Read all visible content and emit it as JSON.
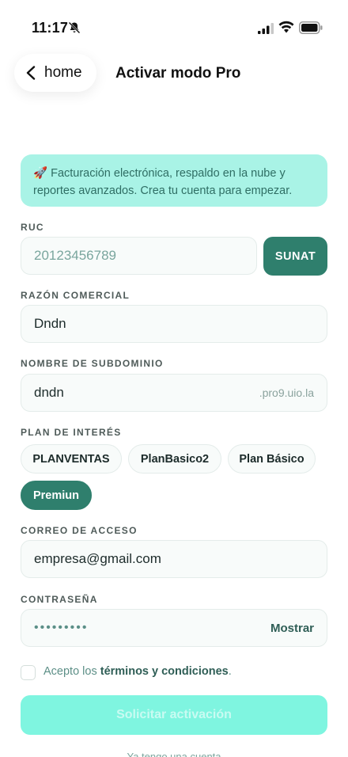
{
  "status_bar": {
    "time": "11:17"
  },
  "header": {
    "back_label": "home",
    "title": "Activar modo Pro"
  },
  "banner": {
    "emoji": "🚀",
    "text": "Facturación electrónica, respaldo en la nube y reportes avanzados. Crea tu cuenta para empezar."
  },
  "ruc": {
    "label": "RUC",
    "placeholder": "20123456789",
    "button_label": "SUNAT"
  },
  "razon": {
    "label": "RAZÓN COMERCIAL",
    "value": "Dndn"
  },
  "subdominio": {
    "label": "NOMBRE DE SUBDOMINIO",
    "value": "dndn",
    "suffix": ".pro9.uio.la"
  },
  "plan": {
    "label": "PLAN DE INTERÉS",
    "options": [
      "PLANVENTAS",
      "PlanBasico2",
      "Plan Básico",
      "Premiun"
    ],
    "selected": "Premiun"
  },
  "correo": {
    "label": "CORREO DE ACCESO",
    "value": "empresa@gmail.com"
  },
  "password": {
    "label": "CONTRASEÑA",
    "masked_value": "•••••••••",
    "toggle_label": "Mostrar"
  },
  "terms": {
    "prefix": "Acepto los ",
    "link": "términos y condiciones",
    "suffix": "."
  },
  "submit": {
    "label": "Solicitar activación"
  },
  "footer": {
    "text": "Ya tengo una cuenta"
  },
  "colors": {
    "accent": "#2f7f6d",
    "banner_bg": "#a9f3e6",
    "submit_bg": "#7ff5e0"
  }
}
